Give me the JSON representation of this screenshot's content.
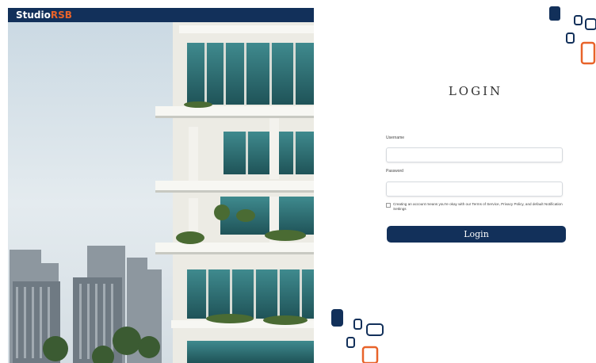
{
  "brand": {
    "name_primary": "Studio",
    "name_accent": "RSB"
  },
  "login": {
    "title": "LOGIN",
    "username_label": "Username",
    "username_value": "",
    "password_label": "Password",
    "password_value": "",
    "terms_text": "Creating an account means you're okay with our Terms of Service, Privacy Policy, and default Notification Settings",
    "submit_label": "Login"
  },
  "colors": {
    "brand_navy": "#12305a",
    "brand_orange": "#e8632a",
    "page_background": "#ffffff"
  },
  "icons": {
    "hero_image": "building-photo",
    "decor": "rounded-square-shapes-icon"
  }
}
